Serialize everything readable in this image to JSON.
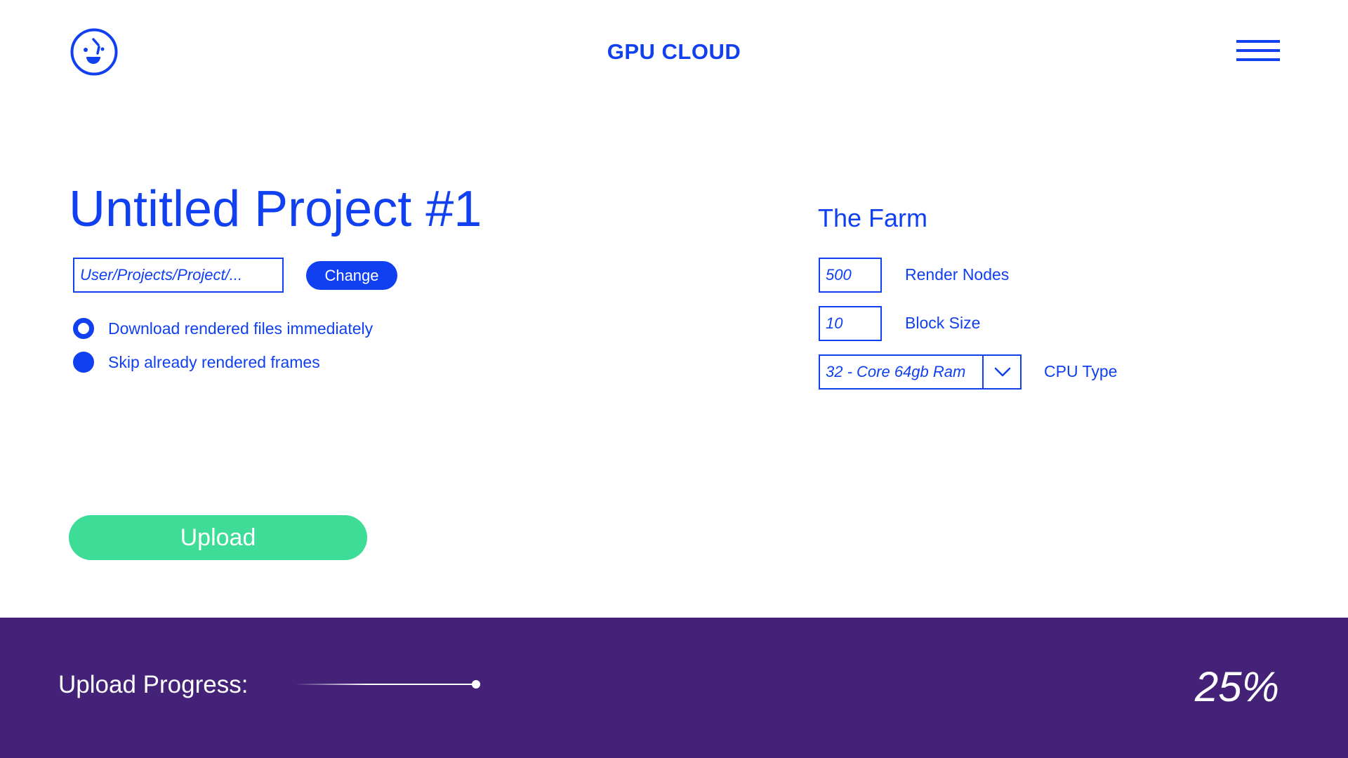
{
  "header": {
    "brand": "GPU CLOUD",
    "logo_icon": "smiley-face-logo-icon",
    "menu_icon": "hamburger-menu-icon"
  },
  "project": {
    "title": "Untitled Project #1",
    "path_value": "User/Projects/Project/...",
    "change_label": "Change",
    "options": [
      {
        "label": "Download rendered files immediately",
        "state": "ring"
      },
      {
        "label": "Skip already rendered frames",
        "state": "filled"
      }
    ],
    "upload_label": "Upload"
  },
  "farm": {
    "title": "The Farm",
    "render_nodes_value": "500",
    "render_nodes_label": "Render Nodes",
    "block_size_value": "10",
    "block_size_label": "Block Size",
    "cpu_type_value": "32 - Core 64gb Ram",
    "cpu_type_label": "CPU Type",
    "dropdown_icon": "chevron-down-icon"
  },
  "footer": {
    "progress_label": "Upload Progress:",
    "progress_percent_text": "25%",
    "progress_fraction": 0.25
  },
  "colors": {
    "accent": "#1040f0",
    "upload_button": "#3ddc97",
    "footer_bg": "#442277",
    "background": "#ffffff"
  }
}
